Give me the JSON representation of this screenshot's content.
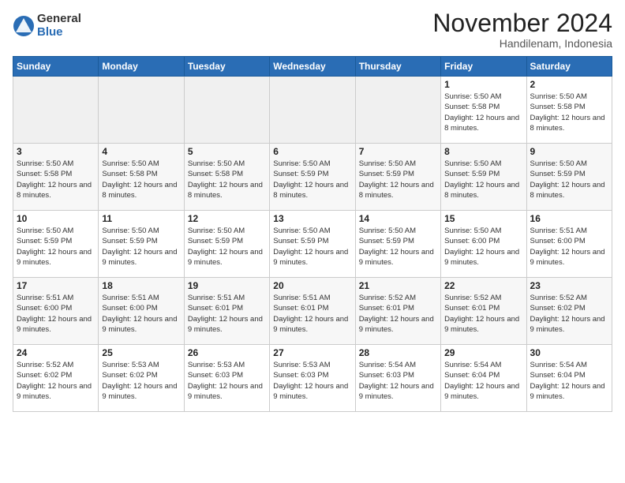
{
  "logo": {
    "general": "General",
    "blue": "Blue"
  },
  "header": {
    "title": "November 2024",
    "subtitle": "Handilenam, Indonesia"
  },
  "weekdays": [
    "Sunday",
    "Monday",
    "Tuesday",
    "Wednesday",
    "Thursday",
    "Friday",
    "Saturday"
  ],
  "weeks": [
    [
      {
        "day": "",
        "info": ""
      },
      {
        "day": "",
        "info": ""
      },
      {
        "day": "",
        "info": ""
      },
      {
        "day": "",
        "info": ""
      },
      {
        "day": "",
        "info": ""
      },
      {
        "day": "1",
        "info": "Sunrise: 5:50 AM\nSunset: 5:58 PM\nDaylight: 12 hours and 8 minutes."
      },
      {
        "day": "2",
        "info": "Sunrise: 5:50 AM\nSunset: 5:58 PM\nDaylight: 12 hours and 8 minutes."
      }
    ],
    [
      {
        "day": "3",
        "info": "Sunrise: 5:50 AM\nSunset: 5:58 PM\nDaylight: 12 hours and 8 minutes."
      },
      {
        "day": "4",
        "info": "Sunrise: 5:50 AM\nSunset: 5:58 PM\nDaylight: 12 hours and 8 minutes."
      },
      {
        "day": "5",
        "info": "Sunrise: 5:50 AM\nSunset: 5:58 PM\nDaylight: 12 hours and 8 minutes."
      },
      {
        "day": "6",
        "info": "Sunrise: 5:50 AM\nSunset: 5:59 PM\nDaylight: 12 hours and 8 minutes."
      },
      {
        "day": "7",
        "info": "Sunrise: 5:50 AM\nSunset: 5:59 PM\nDaylight: 12 hours and 8 minutes."
      },
      {
        "day": "8",
        "info": "Sunrise: 5:50 AM\nSunset: 5:59 PM\nDaylight: 12 hours and 8 minutes."
      },
      {
        "day": "9",
        "info": "Sunrise: 5:50 AM\nSunset: 5:59 PM\nDaylight: 12 hours and 8 minutes."
      }
    ],
    [
      {
        "day": "10",
        "info": "Sunrise: 5:50 AM\nSunset: 5:59 PM\nDaylight: 12 hours and 9 minutes."
      },
      {
        "day": "11",
        "info": "Sunrise: 5:50 AM\nSunset: 5:59 PM\nDaylight: 12 hours and 9 minutes."
      },
      {
        "day": "12",
        "info": "Sunrise: 5:50 AM\nSunset: 5:59 PM\nDaylight: 12 hours and 9 minutes."
      },
      {
        "day": "13",
        "info": "Sunrise: 5:50 AM\nSunset: 5:59 PM\nDaylight: 12 hours and 9 minutes."
      },
      {
        "day": "14",
        "info": "Sunrise: 5:50 AM\nSunset: 5:59 PM\nDaylight: 12 hours and 9 minutes."
      },
      {
        "day": "15",
        "info": "Sunrise: 5:50 AM\nSunset: 6:00 PM\nDaylight: 12 hours and 9 minutes."
      },
      {
        "day": "16",
        "info": "Sunrise: 5:51 AM\nSunset: 6:00 PM\nDaylight: 12 hours and 9 minutes."
      }
    ],
    [
      {
        "day": "17",
        "info": "Sunrise: 5:51 AM\nSunset: 6:00 PM\nDaylight: 12 hours and 9 minutes."
      },
      {
        "day": "18",
        "info": "Sunrise: 5:51 AM\nSunset: 6:00 PM\nDaylight: 12 hours and 9 minutes."
      },
      {
        "day": "19",
        "info": "Sunrise: 5:51 AM\nSunset: 6:01 PM\nDaylight: 12 hours and 9 minutes."
      },
      {
        "day": "20",
        "info": "Sunrise: 5:51 AM\nSunset: 6:01 PM\nDaylight: 12 hours and 9 minutes."
      },
      {
        "day": "21",
        "info": "Sunrise: 5:52 AM\nSunset: 6:01 PM\nDaylight: 12 hours and 9 minutes."
      },
      {
        "day": "22",
        "info": "Sunrise: 5:52 AM\nSunset: 6:01 PM\nDaylight: 12 hours and 9 minutes."
      },
      {
        "day": "23",
        "info": "Sunrise: 5:52 AM\nSunset: 6:02 PM\nDaylight: 12 hours and 9 minutes."
      }
    ],
    [
      {
        "day": "24",
        "info": "Sunrise: 5:52 AM\nSunset: 6:02 PM\nDaylight: 12 hours and 9 minutes."
      },
      {
        "day": "25",
        "info": "Sunrise: 5:53 AM\nSunset: 6:02 PM\nDaylight: 12 hours and 9 minutes."
      },
      {
        "day": "26",
        "info": "Sunrise: 5:53 AM\nSunset: 6:03 PM\nDaylight: 12 hours and 9 minutes."
      },
      {
        "day": "27",
        "info": "Sunrise: 5:53 AM\nSunset: 6:03 PM\nDaylight: 12 hours and 9 minutes."
      },
      {
        "day": "28",
        "info": "Sunrise: 5:54 AM\nSunset: 6:03 PM\nDaylight: 12 hours and 9 minutes."
      },
      {
        "day": "29",
        "info": "Sunrise: 5:54 AM\nSunset: 6:04 PM\nDaylight: 12 hours and 9 minutes."
      },
      {
        "day": "30",
        "info": "Sunrise: 5:54 AM\nSunset: 6:04 PM\nDaylight: 12 hours and 9 minutes."
      }
    ]
  ]
}
